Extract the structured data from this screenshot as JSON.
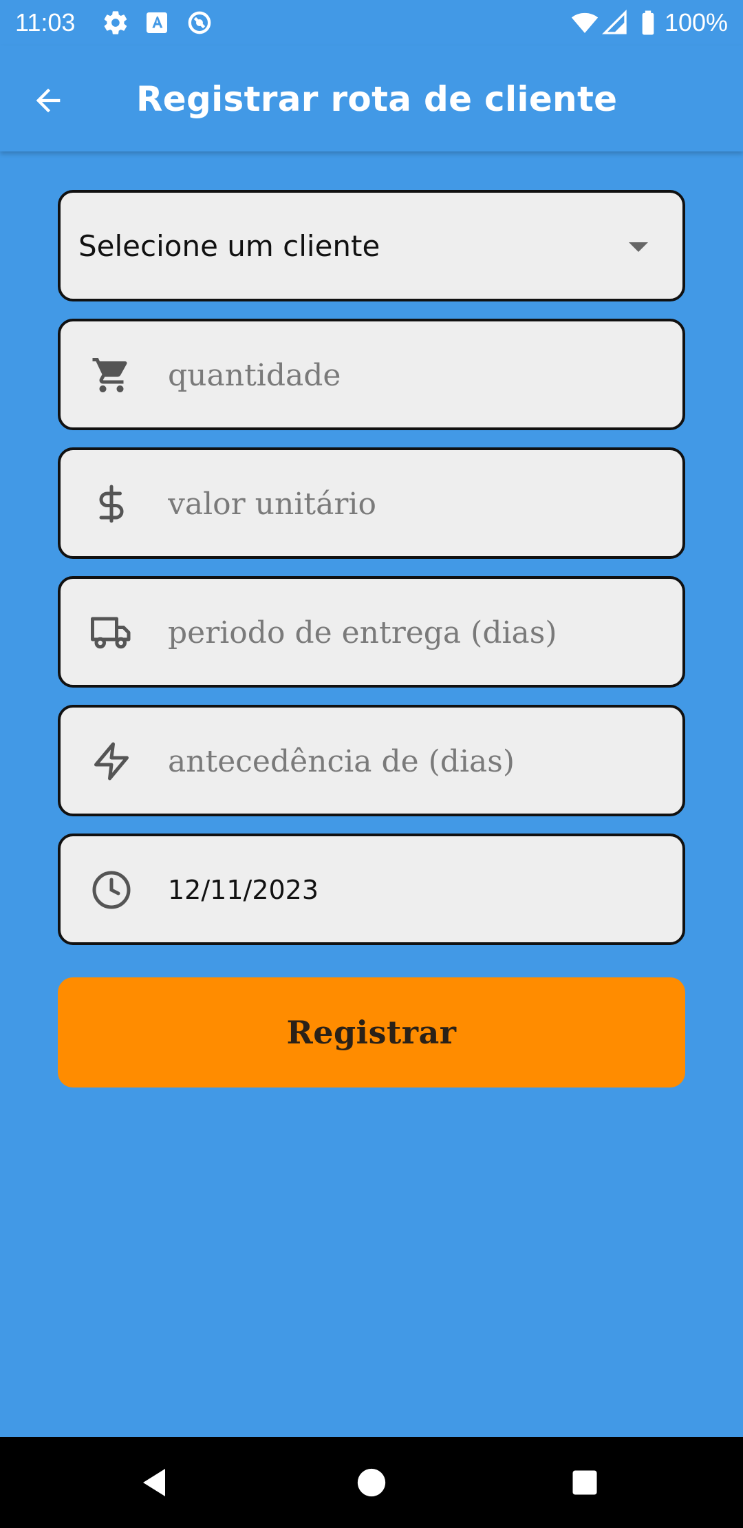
{
  "status_bar": {
    "time": "11:03",
    "battery": "100%",
    "icons": [
      "settings-icon",
      "font-a-icon",
      "sync-circle-icon",
      "wifi-icon",
      "signal-icon",
      "battery-icon"
    ]
  },
  "app_bar": {
    "title": "Registrar rota de cliente",
    "back_icon": "arrow-left-icon"
  },
  "form": {
    "client_select": {
      "value": "Selecione um cliente"
    },
    "quantity": {
      "placeholder": "quantidade",
      "icon": "cart-icon"
    },
    "unit_value": {
      "placeholder": "valor unitário",
      "icon": "dollar-icon"
    },
    "delivery_period": {
      "placeholder": "periodo de entrega (dias)",
      "icon": "truck-icon"
    },
    "advance": {
      "placeholder": "antecedência de (dias)",
      "icon": "lightning-icon"
    },
    "date": {
      "value": "12/11/2023",
      "icon": "clock-icon"
    },
    "submit_label": "Registrar"
  },
  "colors": {
    "background": "#4299e6",
    "field_background": "#eeeeee",
    "button": "#ff8c00",
    "text_white": "#ffffff"
  }
}
